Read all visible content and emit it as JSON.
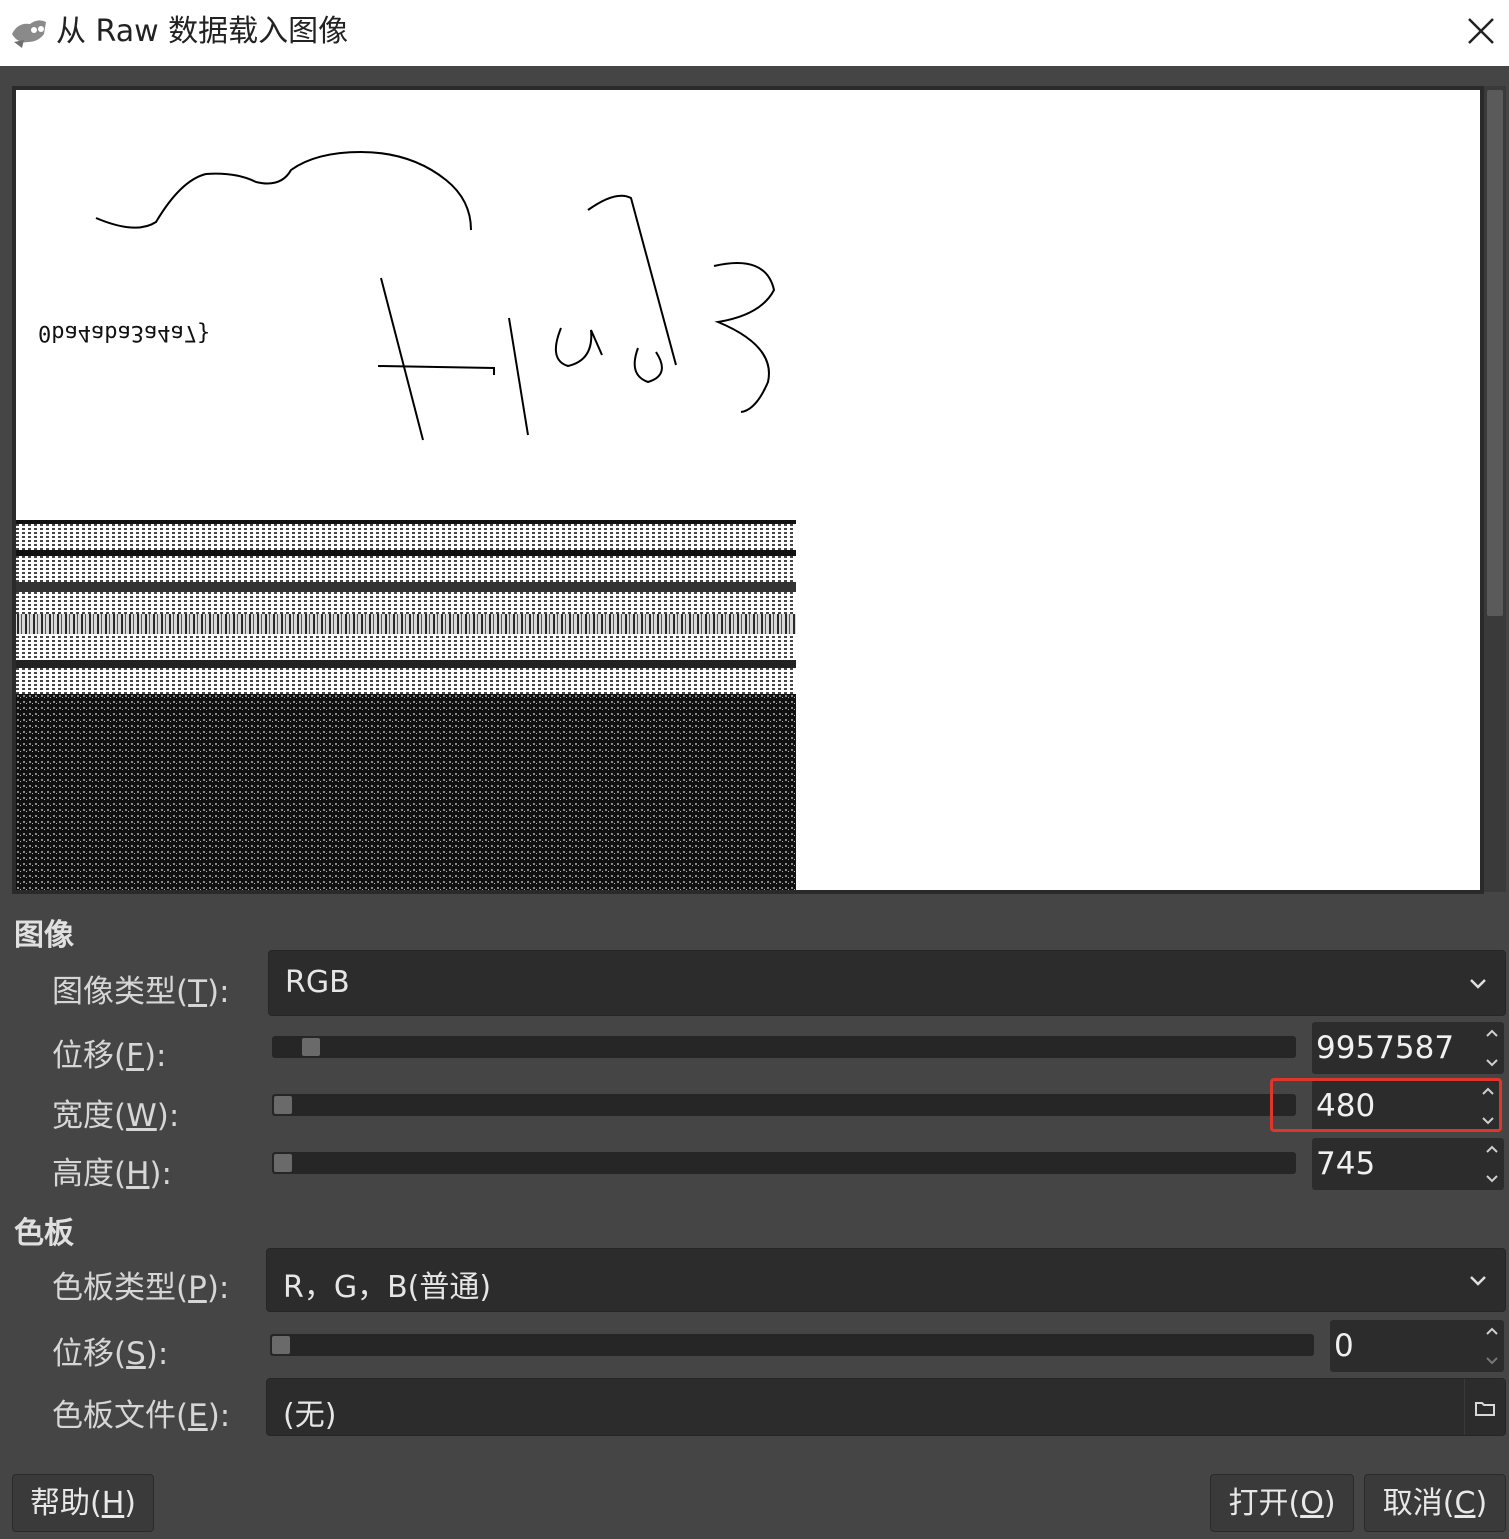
{
  "window": {
    "title": "从 Raw 数据载入图像"
  },
  "preview": {
    "mirrored_text": "0ba4aba3a4a7}"
  },
  "image_section": {
    "title": "图像",
    "image_type": {
      "label_prefix": "图像类型(",
      "mnemonic": "T",
      "label_suffix": "):",
      "value": "RGB"
    },
    "offset": {
      "label_prefix": "位移(",
      "mnemonic": "F",
      "label_suffix": "):",
      "value": "9957587",
      "slider_fraction": 0.03
    },
    "width": {
      "label_prefix": "宽度(",
      "mnemonic": "W",
      "label_suffix": "):",
      "value": "480",
      "slider_fraction": 0.0
    },
    "height": {
      "label_prefix": "高度(",
      "mnemonic": "H",
      "label_suffix": "):",
      "value": "745",
      "slider_fraction": 0.0
    }
  },
  "palette_section": {
    "title": "色板",
    "palette_type": {
      "label_prefix": "色板类型(",
      "mnemonic": "P",
      "label_suffix": "):",
      "value": "R，G，B(普通)"
    },
    "offset": {
      "label_prefix": "位移(",
      "mnemonic": "S",
      "label_suffix": "):",
      "value": "0",
      "slider_fraction": 0.0
    },
    "palette_file": {
      "label_prefix": "色板文件(",
      "mnemonic": "E",
      "label_suffix": "):",
      "value": "(无)"
    }
  },
  "buttons": {
    "help": {
      "prefix": "帮助(",
      "mnemonic": "H",
      "suffix": ")"
    },
    "open": {
      "prefix": "打开(",
      "mnemonic": "O",
      "suffix": ")"
    },
    "cancel": {
      "prefix": "取消(",
      "mnemonic": "C",
      "suffix": ")"
    }
  },
  "colors": {
    "highlight": "#e0352b",
    "dialog_bg": "#454545"
  }
}
